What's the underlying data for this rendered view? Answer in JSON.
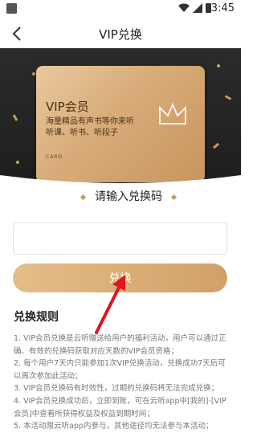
{
  "status_bar": {
    "time": "3:45"
  },
  "nav": {
    "title": "VIP兑换"
  },
  "card": {
    "title": "VIP会员",
    "description": "海量精品有声书等你来听 听课、听书、听段子",
    "label": "CARD"
  },
  "input_section": {
    "title": "请输入兑换码",
    "value": "",
    "placeholder": ""
  },
  "redeem_button": {
    "label": "兑换"
  },
  "rules": {
    "title": "兑换规则",
    "items": [
      "1. VIP会员兑换是云听赠送给用户的福利活动，用户可以通过正确、有效的兑换码获取对应天数的VIP会员资格；",
      "2. 每个用户7天内只能参加1次VIP兑换活动，兑换成功7天后可以再次参加此活动；",
      "3. VIP会员兑换码有时效性，过期的兑换码将无法完成兑换；",
      "4. VIP会员兑换成功后，立即到账，可在云听app中[我的]-[VIP会员]中查看所获得权益及权益到期时间；",
      "5. 本活动限云听app内参与，其他途径均无法参与本活动；"
    ]
  },
  "colors": {
    "accent": "#d6a772",
    "banner_bg": "#222222",
    "rule_text": "#777777"
  },
  "icons": [
    "back-arrow-icon",
    "crown-icon",
    "wifi-icon",
    "signal-icon",
    "battery-icon"
  ]
}
